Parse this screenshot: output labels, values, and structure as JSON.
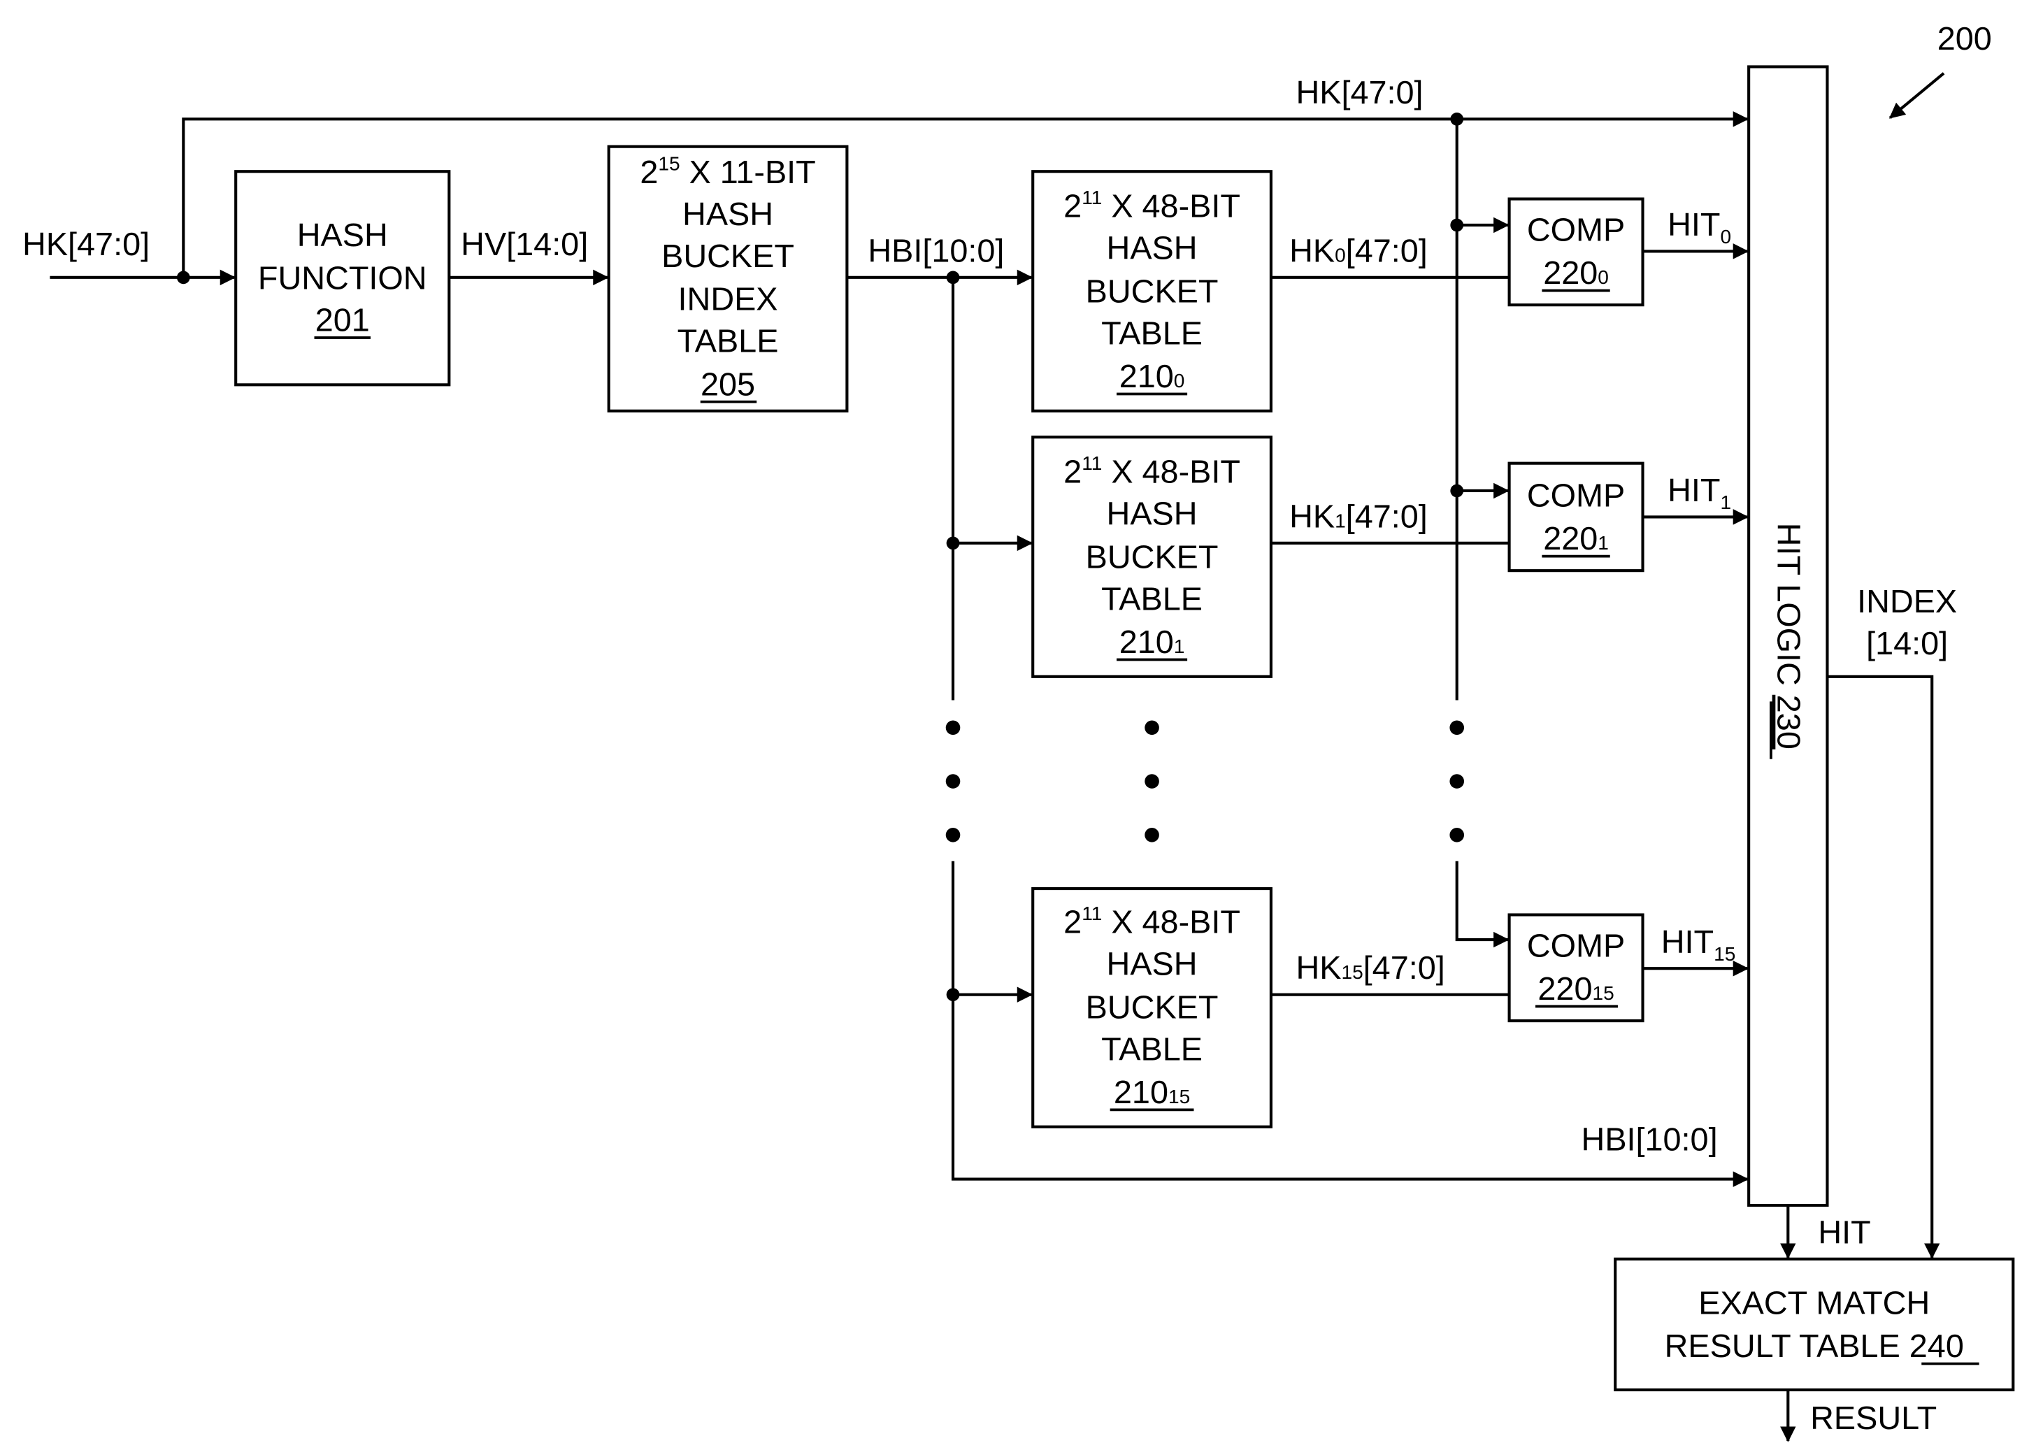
{
  "figure_ref": "200",
  "input": {
    "label": "HK[47:0]"
  },
  "hash_function": {
    "line1": "HASH",
    "line2": "FUNCTION",
    "ref": "201"
  },
  "hv_label": "HV[14:0]",
  "index_table": {
    "base": "2",
    "exp": "15",
    "size_text": " X 11-BIT",
    "line2": "HASH",
    "line3": "BUCKET",
    "line4": "INDEX",
    "line5": "TABLE",
    "ref": "205"
  },
  "hbi_label": "HBI[10:0]",
  "hk_bus_label": "HK[47:0]",
  "bucket_tables": [
    {
      "base": "2",
      "exp": "11",
      "size_text": " X 48-BIT",
      "line2": "HASH",
      "line3": "BUCKET",
      "line4": "TABLE",
      "ref": "210",
      "ref_sub": "0",
      "out_main": "HK",
      "out_sub": "0",
      "out_rest": "[47:0]"
    },
    {
      "base": "2",
      "exp": "11",
      "size_text": " X 48-BIT",
      "line2": "HASH",
      "line3": "BUCKET",
      "line4": "TABLE",
      "ref": "210",
      "ref_sub": "1",
      "out_main": "HK",
      "out_sub": "1",
      "out_rest": "[47:0]"
    },
    {
      "base": "2",
      "exp": "11",
      "size_text": " X 48-BIT",
      "line2": "HASH",
      "line3": "BUCKET",
      "line4": "TABLE",
      "ref": "210",
      "ref_sub": "15",
      "out_main": "HK",
      "out_sub": "15",
      "out_rest": "[47:0]"
    }
  ],
  "comparators": [
    {
      "label": "COMP",
      "ref": "220",
      "ref_sub": "0",
      "hit_main": "HIT",
      "hit_sub": "0"
    },
    {
      "label": "COMP",
      "ref": "220",
      "ref_sub": "1",
      "hit_main": "HIT",
      "hit_sub": "1"
    },
    {
      "label": "COMP",
      "ref": "220",
      "ref_sub": "15",
      "hit_main": "HIT",
      "hit_sub": "15"
    }
  ],
  "hit_logic": {
    "label": "HIT LOGIC ",
    "ref": "230"
  },
  "hbi_to_hit_logic_label": "HBI[10:0]",
  "index_output": {
    "line1": "INDEX",
    "line2": "[14:0]"
  },
  "hit_output_label": "HIT",
  "result_table": {
    "line1": "EXACT MATCH",
    "line2": "RESULT TABLE ",
    "ref": "240"
  },
  "result_label": "RESULT"
}
